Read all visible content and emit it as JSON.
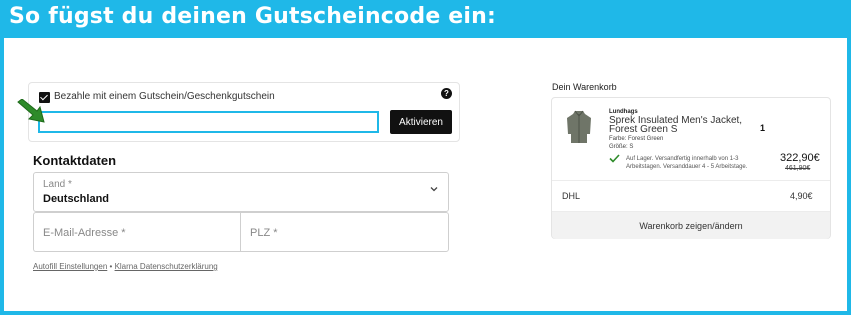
{
  "banner": {
    "title": "So fügst du deinen Gutscheincode ein:"
  },
  "voucher": {
    "checkbox_label": "Bezahle mit einem Gutschein/Geschenkgutschein",
    "checked": true,
    "help_icon": "question-circle-icon",
    "input_value": "",
    "activate_label": "Aktivieren",
    "arrow_icon": "green-arrow-icon",
    "highlight_color": "#1fb8e8"
  },
  "contact": {
    "title": "Kontaktdaten",
    "country_label": "Land *",
    "country_value": "Deutschland",
    "email_placeholder": "E-Mail-Adresse *",
    "plz_placeholder": "PLZ *"
  },
  "footer": {
    "autofill_link": "Autofill Einstellungen",
    "separator": "•",
    "klarna_link": "Klarna Datenschutzerklärung"
  },
  "cart": {
    "title": "Dein Warenkorb",
    "product": {
      "brand": "Lundhags",
      "name": "Sprek Insulated Men's Jacket, Forest Green S",
      "color": "Farbe: Forest Green",
      "size": "Größe: S",
      "quantity": "1",
      "stock": "Auf Lager. Versandfertig innerhalb von 1-3 Arbeitstagen. Versanddauer 4 - 5 Arbeitstage.",
      "price": "322,90€",
      "old_price": "461,90€"
    },
    "shipping": {
      "name": "DHL",
      "price": "4,90€"
    },
    "button_label": "Warenkorb zeigen/ändern"
  }
}
